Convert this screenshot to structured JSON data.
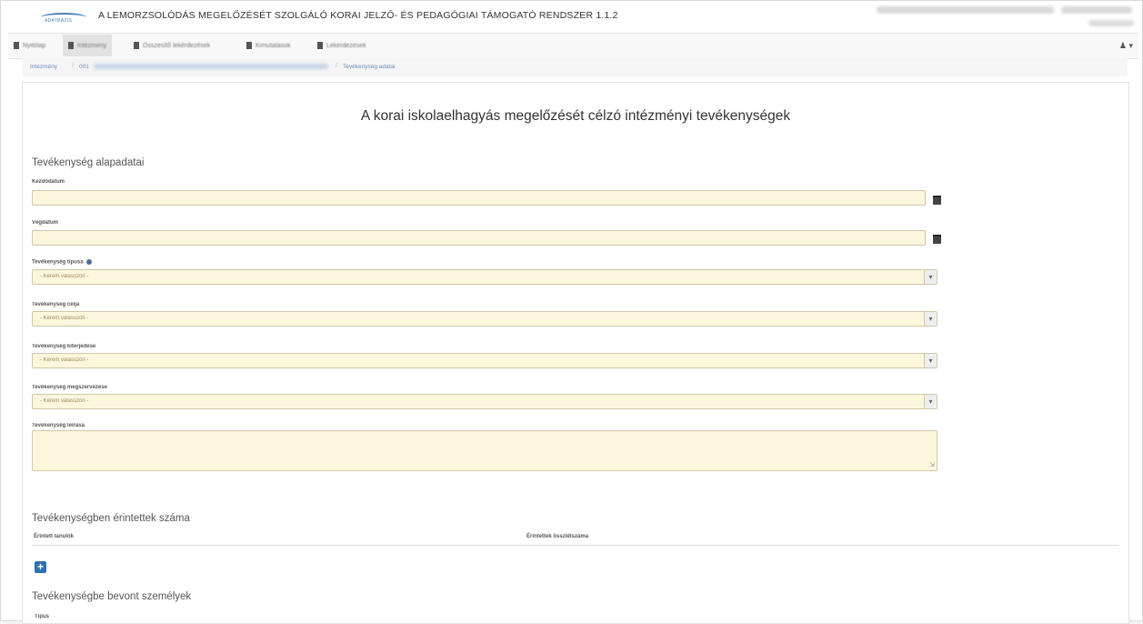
{
  "app": {
    "logo_text": "ADATBÁZIS",
    "title": "A LEMORZSOLÓDÁS MEGELŐZÉSÉT SZOLGÁLÓ KORAI JELZŐ- ÉS PEDAGÓGIAI TÁMOGATÓ RENDSZER 1.1.2"
  },
  "nav": {
    "items": [
      {
        "label": "Nyitólap",
        "icon": "home-icon"
      },
      {
        "label": "Intézmény",
        "icon": "institution-icon"
      },
      {
        "label": "Összesítő lekérdezések",
        "icon": "report-icon"
      },
      {
        "label": "Kimutatások",
        "icon": "chart-icon"
      },
      {
        "label": "Lekérdezések",
        "icon": "list-icon"
      }
    ],
    "user_label": "▾"
  },
  "breadcrumb": {
    "items": [
      "Intézmény",
      "001",
      "Tevékenység adatai"
    ]
  },
  "page": {
    "title": "A korai iskolaelhagyás megelőzését célzó intézményi tevékenységek",
    "section_basic": "Tevékenység alapadatai",
    "section_affected": "Tevékenységben érintettek száma",
    "section_persons": "Tevékenységbe bevont személyek"
  },
  "form": {
    "start_date_label": "Kezdődátum",
    "end_date_label": "Végdátum",
    "type_label": "Tevékenység típusa",
    "goal_label": "Tevékenység célja",
    "scope_label": "Tevékenység kiterjedése",
    "organization_label": "Tevékenység megszervezése",
    "description_label": "Tevékenység leírása",
    "select_placeholder": "- Kérem válasszon -"
  },
  "table": {
    "col1": "Érintett tanulók",
    "col2": "Érintettek összlétszáma"
  },
  "footer": {
    "type_label": "Típus"
  },
  "colors": {
    "input_bg": "#fcf6dd",
    "accent": "#2f6fb0"
  }
}
